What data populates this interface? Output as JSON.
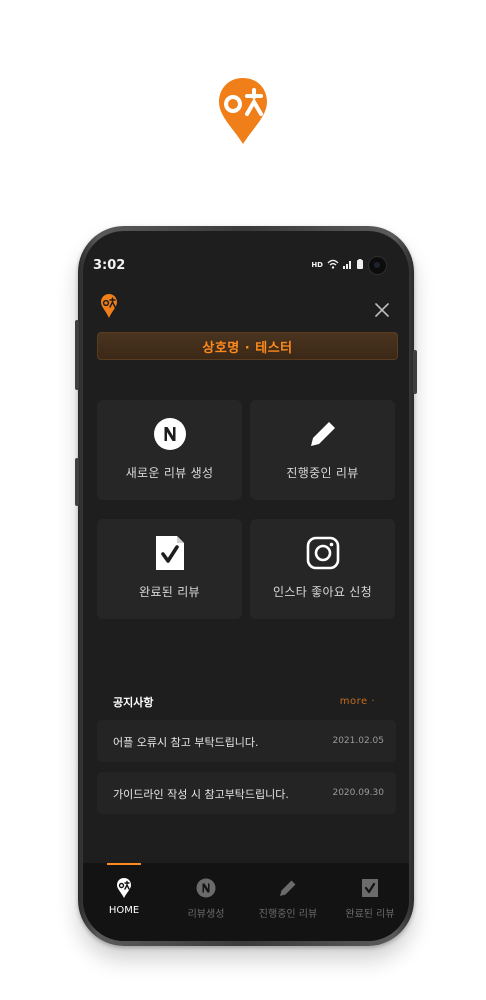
{
  "status_bar": {
    "time": "3:02",
    "network": "HD"
  },
  "header": {
    "store_name": "상호명 · 테스터"
  },
  "tiles": [
    {
      "label": "새로운 리뷰 생성",
      "icon": "naver-n-icon"
    },
    {
      "label": "진행중인 리뷰",
      "icon": "pencil-icon"
    },
    {
      "label": "완료된 리뷰",
      "icon": "checked-document-icon"
    },
    {
      "label": "인스타 좋아요 신청",
      "icon": "instagram-icon"
    }
  ],
  "notices": {
    "title": "공지사항",
    "more": "more ·",
    "items": [
      {
        "text": "어플 오류시 참고 부탁드립니다.",
        "date": "2021.02.05"
      },
      {
        "text": "가이드라인 작성 시 참고부탁드립니다.",
        "date": "2020.09.30"
      }
    ]
  },
  "bottom_nav": [
    {
      "label": "HOME",
      "icon": "home-pin-icon",
      "active": true
    },
    {
      "label": "리뷰생성",
      "icon": "naver-n-icon",
      "active": false
    },
    {
      "label": "진행중인 리뷰",
      "icon": "pencil-icon",
      "active": false
    },
    {
      "label": "완료된 리뷰",
      "icon": "checked-document-icon",
      "active": false
    }
  ],
  "colors": {
    "accent": "#ff8a1e",
    "background": "#1e1e1f",
    "tile": "#262626",
    "nav": "#131313"
  }
}
